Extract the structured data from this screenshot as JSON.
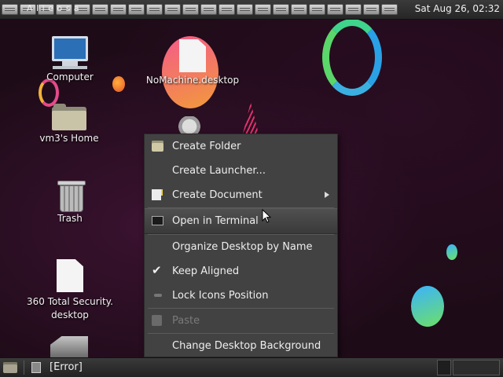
{
  "top_panel": {
    "title_fragment": "A  l  i    e  o    s    a",
    "clock": "Sat Aug 26, 02:32"
  },
  "desktop_icons": [
    {
      "label": "Computer",
      "icon": "computer-icon"
    },
    {
      "label": "NoMachine.desktop",
      "icon": "document-icon"
    },
    {
      "label": "vm3's Home",
      "icon": "home-folder-icon"
    },
    {
      "label": "Trash",
      "icon": "trash-icon"
    },
    {
      "label_line1": "360 Total Security.",
      "label_line2": "desktop",
      "icon": "document-icon"
    }
  ],
  "context_menu": {
    "create_folder": "Create Folder",
    "create_launcher": "Create Launcher...",
    "create_document": "Create Document",
    "open_terminal": "Open in Terminal",
    "organize_by_name": "Organize Desktop by Name",
    "keep_aligned": "Keep Aligned",
    "lock_icons": "Lock Icons Position",
    "paste": "Paste",
    "change_background": "Change Desktop Background"
  },
  "bottom_panel": {
    "task_label": "[Error]"
  },
  "colors": {
    "menu_bg": "#424242",
    "panel_bg": "#2e2e2e",
    "desktop_bg": "#1d0b17"
  }
}
